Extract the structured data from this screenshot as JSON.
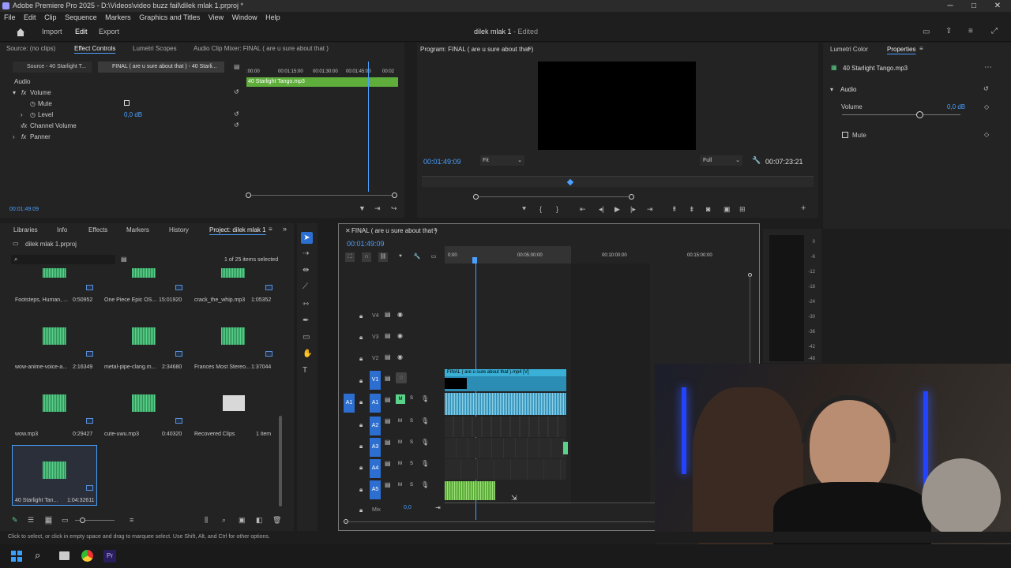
{
  "window": {
    "title": "Adobe Premiere Pro 2025 - D:\\Videos\\video buzz fail\\dilek mlak 1.prproj *",
    "minimize": "─",
    "maximize": "□",
    "close": "✕"
  },
  "menu": [
    "File",
    "Edit",
    "Clip",
    "Sequence",
    "Markers",
    "Graphics and Titles",
    "View",
    "Window",
    "Help"
  ],
  "topnav": {
    "import": "Import",
    "edit": "Edit",
    "export": "Export",
    "project_title": "dilek mlak 1",
    "status": "- Edited"
  },
  "source_panel": {
    "tabs": [
      "Source: (no clips)",
      "Effect Controls",
      "Lumetri Scopes",
      "Audio Clip Mixer: FINAL ( are u sure about that )"
    ],
    "subtabs": [
      "Source - 40 Starlight T...",
      "FINAL ( are u sure about that ) - 40 Starli..."
    ],
    "ruler": [
      ":00:00",
      "00:01:15:00",
      "00:01:30:00",
      "00:01:45:00",
      "00:02"
    ],
    "clip_name": "40 Starlight Tango.mp3",
    "section": "Audio",
    "rows": {
      "volume": "Volume",
      "mute": "Mute",
      "level": "Level",
      "level_value": "0,0 dB",
      "channel_volume": "Channel Volume",
      "panner": "Panner"
    },
    "timecode": "00:01:49:09"
  },
  "program": {
    "title": "Program: FINAL ( are u sure about that )",
    "timecode": "00:01:49:09",
    "fit": "Fit",
    "quality": "Full",
    "duration": "00:07:23:21"
  },
  "properties": {
    "tabs": [
      "Lumetri Color",
      "Properties"
    ],
    "clip": "40 Starlight Tango.mp3",
    "section": "Audio",
    "volume_label": "Volume",
    "volume_value": "0,0 dB",
    "mute": "Mute"
  },
  "project": {
    "tabs": [
      "Libraries",
      "Info",
      "Effects",
      "Markers",
      "History",
      "Project: dilek mlak 1"
    ],
    "file": "dilek mlak 1.prproj",
    "selection": "1 of 25 items selected",
    "items": [
      {
        "name": "Footsteps, Human, ...",
        "dur": "0:50952"
      },
      {
        "name": "One Piece Epic OS...",
        "dur": "15:01920"
      },
      {
        "name": "crack_the_whip.mp3",
        "dur": "1:05352"
      },
      {
        "name": "wow-anime-voice-a...",
        "dur": "2:16349"
      },
      {
        "name": "metal-pipe-clang.m...",
        "dur": "2:34680"
      },
      {
        "name": "Frances Most Stereo...",
        "dur": "1:37044"
      },
      {
        "name": "wow.mp3",
        "dur": "0:29427"
      },
      {
        "name": "cute-uwu.mp3",
        "dur": "0:40320"
      },
      {
        "name": "Recovered Clips",
        "dur": "1 item"
      },
      {
        "name": "40 Starlight Tan...",
        "dur": "1:04:32611"
      }
    ]
  },
  "timeline": {
    "title": "FINAL ( are u sure about that )",
    "timecode": "00:01:49:09",
    "ruler": [
      "0:00",
      "00:05:00:00",
      "00:10:00:00",
      "00:15:00:00"
    ],
    "tracks": [
      "V4",
      "V3",
      "V2",
      "V1",
      "A1",
      "A2",
      "A3",
      "A4",
      "A5",
      "Mix"
    ],
    "src_v": "V1",
    "src_a": "A1",
    "video_clip": "FINAL ( are u sure about that ).mp4 [V]",
    "mix_value": "0,0",
    "m": "M",
    "s": "S"
  },
  "meters": [
    "0",
    "-6",
    "-12",
    "-18",
    "-24",
    "-30",
    "-36",
    "-42",
    "-48"
  ],
  "status": "Click to select, or click in empty space and drag to marquee select. Use Shift, Alt, and Ctrl for other options."
}
